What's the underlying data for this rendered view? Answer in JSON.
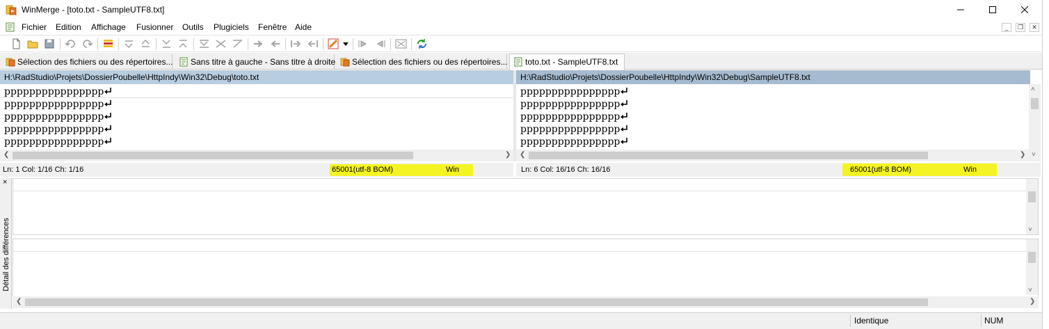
{
  "window": {
    "title": "WinMerge - [toto.txt - SampleUTF8.txt]",
    "minimize": "—",
    "maximize": "☐",
    "close": "✕"
  },
  "menu": {
    "items": [
      "Fichier",
      "Edition",
      "Affichage",
      "Fusionner",
      "Outils",
      "Plugiciels",
      "Fenêtre",
      "Aide"
    ],
    "mdi_minimize": "_",
    "mdi_restore": "❐",
    "mdi_close": "✕"
  },
  "tabs": [
    {
      "label": "Sélection des fichiers ou des répertoires...",
      "icon": "folder-compare-icon",
      "active": false
    },
    {
      "label": "Sans titre à gauche - Sans titre à droite",
      "icon": "file-compare-icon",
      "active": false
    },
    {
      "label": "Sélection des fichiers ou des répertoires...",
      "icon": "folder-compare-icon",
      "active": false
    },
    {
      "label": "toto.txt - SampleUTF8.txt",
      "icon": "file-compare-icon",
      "active": true
    }
  ],
  "left_pane": {
    "path": "H:\\RadStudio\\Projets\\DossierPoubelle\\HttpIndy\\Win32\\Debug\\toto.txt",
    "lines": [
      "pppppppppppppppp",
      "pppppppppppppppp",
      "pppppppppppppppp",
      "pppppppppppppppp",
      "pppppppppppppppp"
    ],
    "status": {
      "position": "Ln: 1  Col: 1/16  Ch: 1/16",
      "encoding": "65001(utf-8 BOM)",
      "eol": "Win"
    }
  },
  "right_pane": {
    "path": "H:\\RadStudio\\Projets\\DossierPoubelle\\HttpIndy\\Win32\\Debug\\SampleUTF8.txt",
    "lines": [
      "pppppppppppppppp",
      "pppppppppppppppp",
      "pppppppppppppppp",
      "pppppppppppppppp",
      "pppppppppppppppp"
    ],
    "status": {
      "position": "Ln: 6  Col: 16/16  Ch: 16/16",
      "encoding": "65001(utf-8 BOM)",
      "eol": "Win"
    }
  },
  "detail": {
    "close": "×",
    "label": "Détail des différences"
  },
  "statusbar": {
    "result": "Identique",
    "num": "NUM"
  },
  "colors": {
    "highlight": "#f5f500",
    "left_header": "#b9cde0",
    "right_header": "#a6bbd0"
  }
}
